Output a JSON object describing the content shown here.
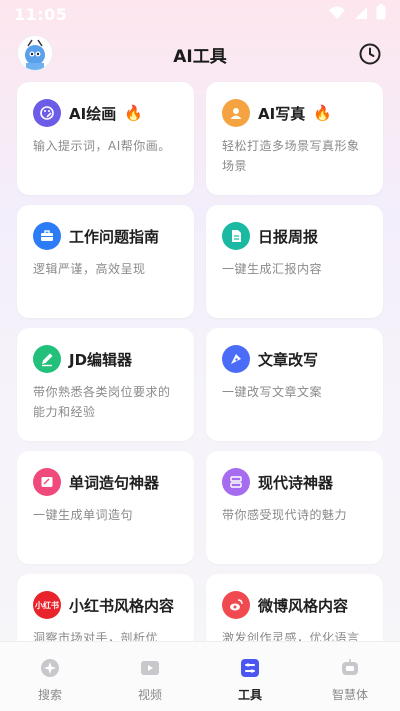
{
  "status_bar": {
    "time": "11:05"
  },
  "header": {
    "title": "AI工具"
  },
  "cards": [
    {
      "title": "AI绘画",
      "desc": "输入提示词，AI帮你画。",
      "hot": true,
      "color": "#6c5ce7"
    },
    {
      "title": "AI写真",
      "desc": "轻松打造多场景写真形象场景",
      "hot": true,
      "color": "#f5a340"
    },
    {
      "title": "工作问题指南",
      "desc": "逻辑严谨，高效呈现",
      "hot": false,
      "color": "#2b7cf6"
    },
    {
      "title": "日报周报",
      "desc": "一键生成汇报内容",
      "hot": false,
      "color": "#19b9a2"
    },
    {
      "title": "JD编辑器",
      "desc": "带你熟悉各类岗位要求的能力和经验",
      "hot": false,
      "color": "#22c07a"
    },
    {
      "title": "文章改写",
      "desc": "一键改写文章文案",
      "hot": false,
      "color": "#4a6cf7"
    },
    {
      "title": "单词造句神器",
      "desc": "一键生成单词造句",
      "hot": false,
      "color": "#f04a7c"
    },
    {
      "title": "现代诗神器",
      "desc": "带你感受现代诗的魅力",
      "hot": false,
      "color": "#a66cf0"
    },
    {
      "title": "小红书风格内容",
      "desc": "洞察市场对手，剖析优",
      "hot": false,
      "color": "#e8232c",
      "icon_text": "小红书"
    },
    {
      "title": "微博风格内容",
      "desc": "激发创作灵感，优化语言",
      "hot": false,
      "color": "#f04a50"
    }
  ],
  "fire_icon": "🔥",
  "tabbar": {
    "items": [
      {
        "label": "搜索",
        "active": false
      },
      {
        "label": "视频",
        "active": false
      },
      {
        "label": "工具",
        "active": true
      },
      {
        "label": "智慧体",
        "active": false
      }
    ]
  }
}
